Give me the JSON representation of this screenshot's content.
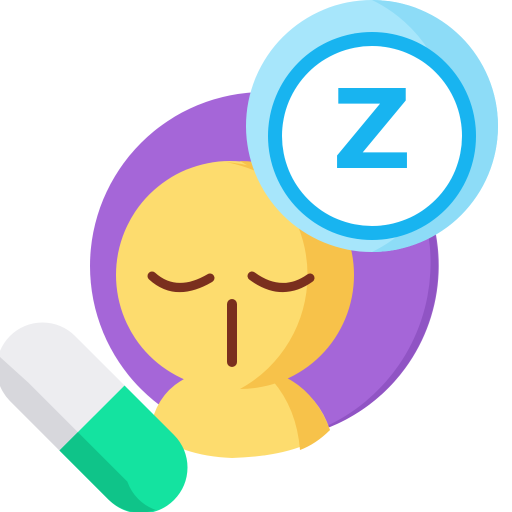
{
  "icon": {
    "subject": "sleeping-person-with-pill",
    "sleep_letter": "Z",
    "colors": {
      "background": "#ffffff",
      "purple_circle": "#A566D8",
      "purple_circle_shadow": "#8E52C2",
      "face": "#FDDC6E",
      "face_shadow": "#F7C24A",
      "facial_features": "#7A2F1E",
      "bubble_outer": "#A7E6FB",
      "bubble_ring": "#18B4F0",
      "bubble_inner": "#FFFFFF",
      "letter": "#18B4F0",
      "pill_light": "#EDEDF0",
      "pill_light_shadow": "#D7D7DC",
      "pill_green": "#14E3A0",
      "pill_green_shadow": "#0FC489"
    }
  }
}
